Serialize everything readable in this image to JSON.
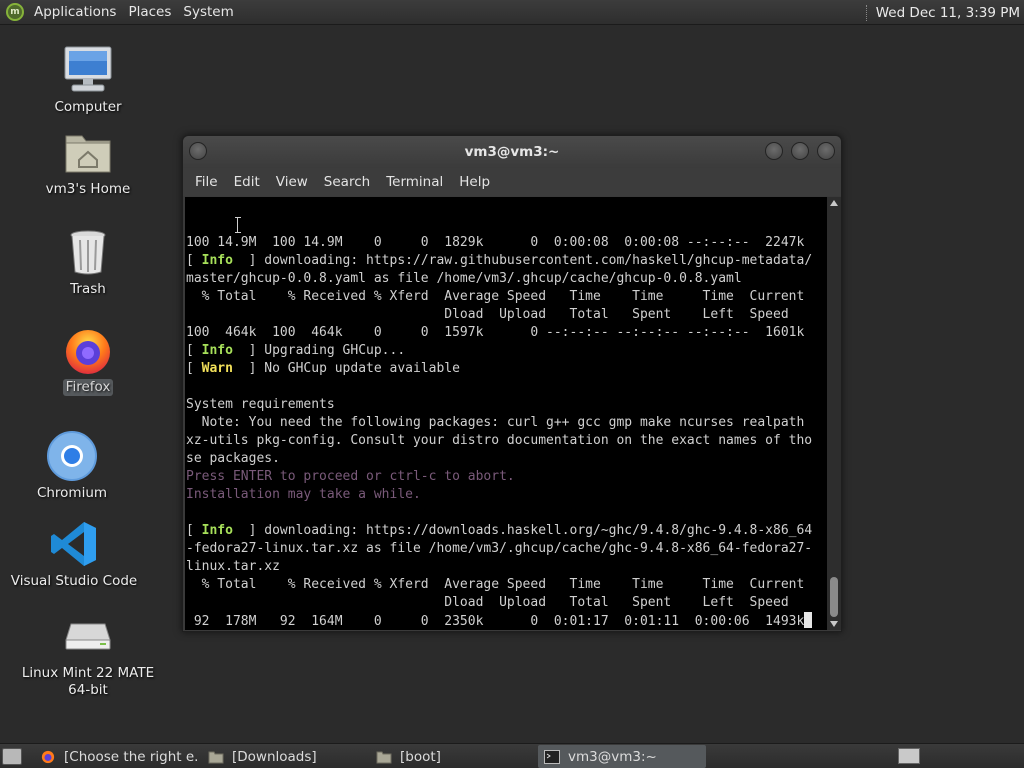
{
  "top_panel": {
    "menu": [
      "Applications",
      "Places",
      "System"
    ],
    "clock": "Wed Dec 11,  3:39 PM"
  },
  "desktop_icons": [
    {
      "label": "Computer",
      "icon": "computer-icon"
    },
    {
      "label": "vm3's Home",
      "icon": "home-folder-icon"
    },
    {
      "label": "Trash",
      "icon": "trash-icon"
    },
    {
      "label": "Firefox",
      "icon": "firefox-icon",
      "selected": true
    },
    {
      "label": "Chromium",
      "icon": "chromium-icon"
    },
    {
      "label": "Visual Studio Code",
      "icon": "vscode-icon"
    },
    {
      "label": "Linux Mint 22 MATE 64-bit",
      "icon": "drive-icon",
      "label_lines": [
        "Linux Mint 22 MATE",
        "64-bit"
      ]
    }
  ],
  "terminal": {
    "title": "vm3@vm3:~",
    "menu": [
      "File",
      "Edit",
      "View",
      "Search",
      "Terminal",
      "Help"
    ],
    "lines": [
      {
        "text": "100 14.9M  100 14.9M    0     0  1829k      0  0:00:08  0:00:08 --:--:--  2247k"
      },
      {
        "tag": "Info",
        "text": " downloading: https://raw.githubusercontent.com/haskell/ghcup-metadata/"
      },
      {
        "text": "master/ghcup-0.0.8.yaml as file /home/vm3/.ghcup/cache/ghcup-0.0.8.yaml"
      },
      {
        "text": "  % Total    % Received % Xferd  Average Speed   Time    Time     Time  Current"
      },
      {
        "text": "                                 Dload  Upload   Total   Spent    Left  Speed"
      },
      {
        "text": "100  464k  100  464k    0     0  1597k      0 --:--:-- --:--:-- --:--:--  1601k"
      },
      {
        "tag": "Info",
        "text": " Upgrading GHCup..."
      },
      {
        "tag": "Warn",
        "text": " No GHCup update available"
      },
      {
        "text": ""
      },
      {
        "text": "System requirements"
      },
      {
        "text": "  Note: You need the following packages: curl g++ gcc gmp make ncurses realpath"
      },
      {
        "text": "xz-utils pkg-config. Consult your distro documentation on the exact names of tho"
      },
      {
        "text": "se packages."
      },
      {
        "text": "Press ENTER to proceed or ctrl-c to abort.",
        "dim": true
      },
      {
        "text": "Installation may take a while.",
        "dim": true
      },
      {
        "text": ""
      },
      {
        "tag": "Info",
        "text": " downloading: https://downloads.haskell.org/~ghc/9.4.8/ghc-9.4.8-x86_64"
      },
      {
        "text": "-fedora27-linux.tar.xz as file /home/vm3/.ghcup/cache/ghc-9.4.8-x86_64-fedora27-"
      },
      {
        "text": "linux.tar.xz"
      },
      {
        "text": "  % Total    % Received % Xferd  Average Speed   Time    Time     Time  Current"
      },
      {
        "text": "                                 Dload  Upload   Total   Spent    Left  Speed"
      },
      {
        "text": " 92  178M   92  164M    0     0  2350k      0  0:01:17  0:01:11  0:00:06  1493k",
        "cursor": true
      }
    ]
  },
  "taskbar": {
    "items": [
      {
        "label": "[Choose the right e...",
        "icon": "firefox-icon"
      },
      {
        "label": "[Downloads]",
        "icon": "folder-icon"
      },
      {
        "label": "[boot]",
        "icon": "folder-icon"
      },
      {
        "label": "vm3@vm3:~",
        "icon": "terminal-icon",
        "active": true
      }
    ]
  },
  "colors": {
    "desktop_bg": "#2b2b2b",
    "terminal_bg": "#000000",
    "info_tag": "#a7e05a",
    "warn_tag": "#f2e05a",
    "dim_text": "#7a5a7a"
  }
}
